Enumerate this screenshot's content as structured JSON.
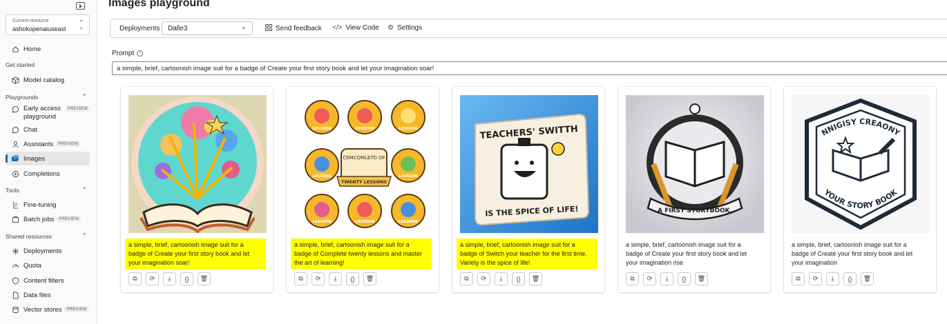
{
  "sidebar": {
    "current_resource_label": "Current resource",
    "current_resource_value": "ashokopenaiuseast",
    "home": "Home",
    "get_started_header": "Get started",
    "model_catalog": "Model catalog",
    "playgrounds_header": "Playgrounds",
    "early_access": "Early access playground",
    "early_access_badge": "PREVIEW",
    "chat": "Chat",
    "assistants": "Assistants",
    "assistants_badge": "PREVIEW",
    "images": "Images",
    "completions": "Completions",
    "tools_header": "Tools",
    "fine_tuning": "Fine-tuning",
    "batch_jobs": "Batch jobs",
    "batch_jobs_badge": "PREVIEW",
    "shared_header": "Shared resources",
    "deployments": "Deployments",
    "quota": "Quota",
    "content_filters": "Content filters",
    "data_files": "Data files",
    "vector_stores": "Vector stores",
    "vector_stores_badge": "PREVIEW"
  },
  "page": {
    "title": "Images playground"
  },
  "toolbar": {
    "deployments_label": "Deployments",
    "deployment_value": "Dalle3",
    "send_feedback": "Send feedback",
    "view_code": "View Code",
    "settings": "Settings"
  },
  "prompt": {
    "label": "Prompt",
    "value": "a simple, brief, cartoonish image suit for a badge of Create your first story book and let your imagination soar!"
  },
  "images": [
    {
      "caption": "a simple, brief, cartoonish image suit for a badge of Create your first story book and let your imagination soar!",
      "highlighted": true
    },
    {
      "caption": "a simple, brief, cartoonish image suit for a badge of Complete twenty lessons and master the art of learning!",
      "highlighted": true,
      "badge_title_1": "CEMCOMLETD OF",
      "badge_title_2": "TWENTY LESSONS",
      "badge_word": "LESSERN"
    },
    {
      "caption": "a simple, brief, cartoonish image suit for a badge of Switch your teacher for the first time. Variety is the spice of life!",
      "highlighted": true,
      "badge_top": "TEACHERS' SWITTH",
      "badge_bottom": "IS THE SPICE OF LIFE!"
    },
    {
      "caption": "a simple, brief, cartoonish image suit for a badge of Create your first story book and let your imagination rise",
      "highlighted": false,
      "ribbon": "A FIRST STORYBOOK."
    },
    {
      "caption": "a simple, brief, cartoonish image suit for a badge of Create your first story book and let your imagination",
      "highlighted": false,
      "arc_top": "NNIGISY CREAONY",
      "arc_bottom": "YOUR STORY BOOK"
    }
  ],
  "colors": {
    "accent": "#0f6cbd",
    "highlight": "#ffff00"
  }
}
